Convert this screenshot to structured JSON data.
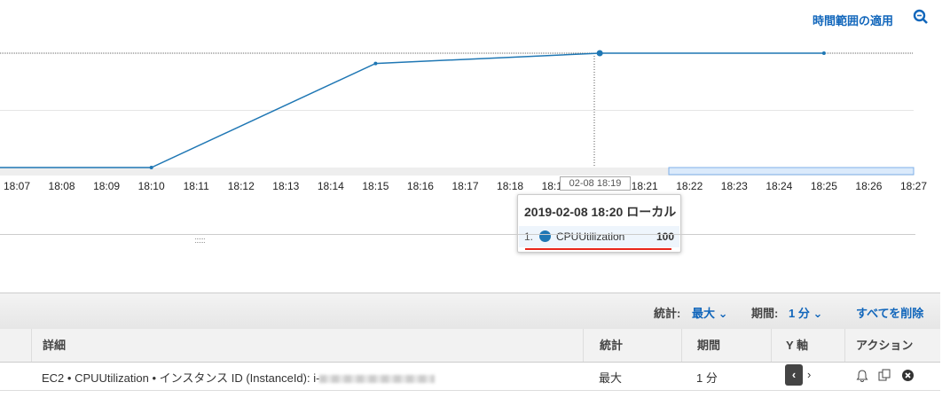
{
  "header": {
    "apply_time_range": "時間範囲の適用",
    "zoom_icon": "zoom-out-icon"
  },
  "chart_data": {
    "type": "line",
    "series": [
      {
        "name": "CPUUtilization",
        "color": "#1f77b4",
        "x": [
          "18:07",
          "18:10",
          "18:15",
          "18:20",
          "18:25"
        ],
        "y": [
          0,
          0,
          91,
          100,
          100
        ]
      }
    ],
    "x_ticks": [
      "18:07",
      "18:08",
      "18:09",
      "18:10",
      "18:11",
      "18:12",
      "18:13",
      "18:14",
      "18:15",
      "18:16",
      "18:17",
      "18:18",
      "18:19",
      "18:20",
      "18:21",
      "18:22",
      "18:23",
      "18:24",
      "18:25",
      "18:26",
      "18:27"
    ],
    "ylim": [
      0,
      100
    ],
    "grid": true,
    "hover_x_label": "02-08 18:19",
    "tooltip": {
      "title": "2019-02-08 18:20 ローカル",
      "index": "1.",
      "metric": "CPUUtilization",
      "value": "100"
    }
  },
  "toolbar": {
    "stat_label": "統計:",
    "stat_value": "最大",
    "period_label": "期間:",
    "period_value": "1 分",
    "remove_all": "すべてを削除"
  },
  "table": {
    "headers": [
      "詳細",
      "統計",
      "期間",
      "Y 軸",
      "アクション"
    ],
    "rows": [
      {
        "details": "EC2 • CPUUtilization • インスタンス ID (InstanceId): i-",
        "stat": "最大",
        "period": "1 分",
        "y_left": "‹",
        "y_right": "›"
      }
    ]
  }
}
